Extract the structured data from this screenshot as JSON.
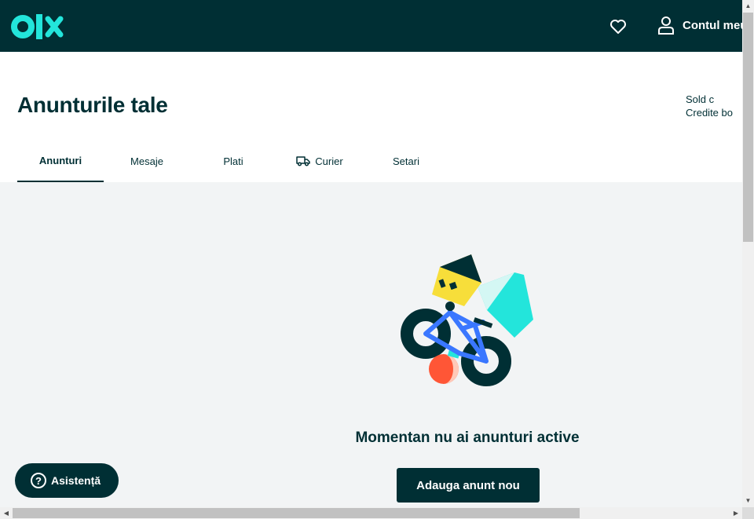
{
  "header": {
    "logo_text": "olx",
    "favorites_icon": "heart-icon",
    "account_icon": "user-icon",
    "account_label": "Contul meu"
  },
  "page": {
    "title": "Anunturile tale",
    "balance_line1": "Sold c",
    "balance_line2": "Credite bo"
  },
  "tabs": [
    {
      "label": "Anunturi",
      "active": true
    },
    {
      "label": "Mesaje"
    },
    {
      "label": "Plati"
    },
    {
      "label": "Curier",
      "icon": "truck-icon"
    },
    {
      "label": "Setari"
    }
  ],
  "empty_state": {
    "message": "Momentan nu ai anunturi active",
    "button_label": "Adauga anunt nou"
  },
  "help": {
    "icon": "question-icon",
    "label": "Asistență"
  },
  "colors": {
    "brand_dark": "#002f34",
    "brand_teal": "#23e5db",
    "background": "#f2f4f5",
    "yellow": "#f7de3a",
    "red": "#ff5636",
    "blue": "#3a77ff"
  }
}
